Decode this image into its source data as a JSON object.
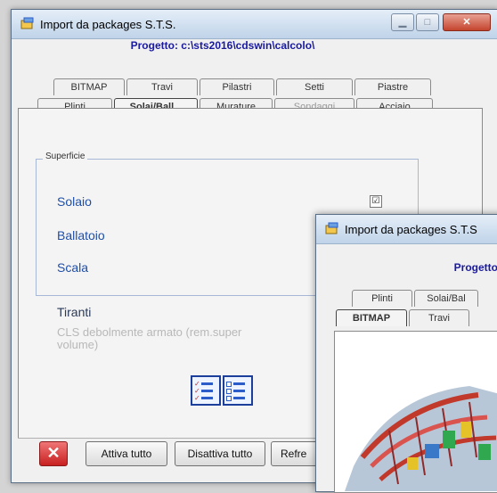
{
  "main_window": {
    "title": "Import da packages S.T.S.",
    "project_label": "Progetto:",
    "project_path": "c:\\sts2016\\cdswin\\calcolo\\",
    "tabs_row1": [
      "BITMAP",
      "Travi",
      "Pilastri",
      "Setti",
      "Piastre"
    ],
    "tabs_row2": [
      "Plinti",
      "Solai/Ball...",
      "Murature",
      "Sondaggi",
      "Acciaio"
    ],
    "selected_tab": "Solai/Ball...",
    "disabled_tab": "Sondaggi",
    "group_title": "Superficie",
    "options": [
      {
        "label": "Solaio",
        "checked": true
      },
      {
        "label": "Ballatoio",
        "checked": false
      },
      {
        "label": "Scala",
        "checked": false
      }
    ],
    "checkbox_mark": "☑",
    "tiranti_label": "Tiranti",
    "cls_text": "CLS debolmente armato (rem.super",
    "cls_text2": "volume)",
    "buttons": {
      "close_symbol": "✕",
      "activate_all": "Attiva tutto",
      "deactivate_all": "Disattiva tutto",
      "refresh": "Refre"
    }
  },
  "second_window": {
    "title": "Import da packages S.T.S",
    "project_label": "Progetto:",
    "tabs_row1": [
      "Plinti",
      "Solai/Bal"
    ],
    "tabs_row2": [
      "BITMAP",
      "Travi"
    ],
    "selected_tab": "BITMAP"
  },
  "colors": {
    "accent_blue": "#1f4fa8",
    "project_text": "#1a1aa0",
    "close_red": "#c82020"
  }
}
